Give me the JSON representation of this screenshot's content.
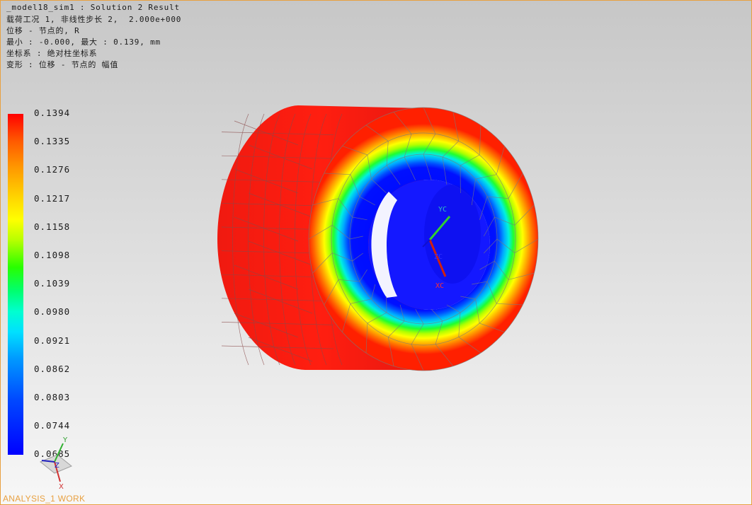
{
  "header": {
    "lines": [
      "_model18_sim1 : Solution 2 Result",
      "载荷工况 1, 非线性步长 2,  2.000e+000",
      "位移 - 节点的, R",
      "最小 : -0.000, 最大 : 0.139, mm",
      "坐标系 : 绝对柱坐标系",
      "变形 : 位移 - 节点的 幅值"
    ]
  },
  "legend": {
    "values": [
      "0.1394",
      "0.1335",
      "0.1276",
      "0.1217",
      "0.1158",
      "0.1098",
      "0.1039",
      "0.0980",
      "0.0921",
      "0.0862",
      "0.0803",
      "0.0744",
      "0.0685"
    ],
    "colors": [
      "#ff0000",
      "#ff6400",
      "#ffa000",
      "#ffdc00",
      "#ffff00",
      "#9cff00",
      "#00ff28",
      "#00ffb4",
      "#00e0ff",
      "#00a8ff",
      "#0064ff",
      "#0028ff",
      "#0000ff"
    ]
  },
  "wcs": {
    "x": "XC",
    "y": "YC",
    "z": "ZC"
  },
  "triad": {
    "x": "X",
    "y": "Y",
    "z": "Z"
  },
  "view_name": "ANALYSIS_1 WORK"
}
